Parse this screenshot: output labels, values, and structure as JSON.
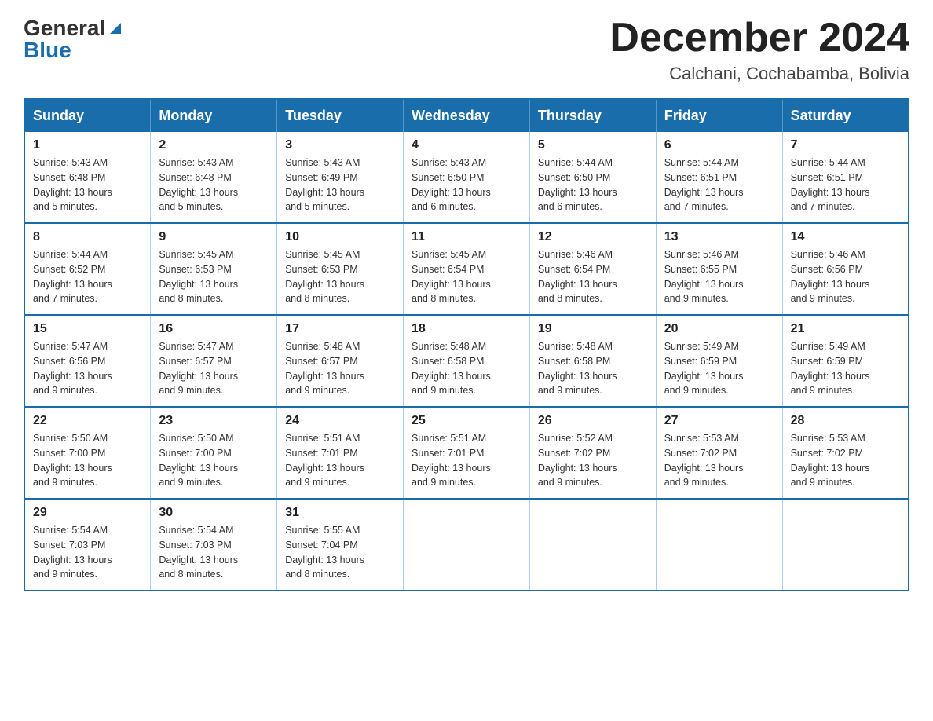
{
  "header": {
    "logo_line1": "General",
    "logo_line2": "Blue",
    "month_title": "December 2024",
    "location": "Calchani, Cochabamba, Bolivia"
  },
  "days_of_week": [
    "Sunday",
    "Monday",
    "Tuesday",
    "Wednesday",
    "Thursday",
    "Friday",
    "Saturday"
  ],
  "weeks": [
    [
      {
        "day": "1",
        "sunrise": "5:43 AM",
        "sunset": "6:48 PM",
        "daylight": "13 hours and 5 minutes."
      },
      {
        "day": "2",
        "sunrise": "5:43 AM",
        "sunset": "6:48 PM",
        "daylight": "13 hours and 5 minutes."
      },
      {
        "day": "3",
        "sunrise": "5:43 AM",
        "sunset": "6:49 PM",
        "daylight": "13 hours and 5 minutes."
      },
      {
        "day": "4",
        "sunrise": "5:43 AM",
        "sunset": "6:50 PM",
        "daylight": "13 hours and 6 minutes."
      },
      {
        "day": "5",
        "sunrise": "5:44 AM",
        "sunset": "6:50 PM",
        "daylight": "13 hours and 6 minutes."
      },
      {
        "day": "6",
        "sunrise": "5:44 AM",
        "sunset": "6:51 PM",
        "daylight": "13 hours and 7 minutes."
      },
      {
        "day": "7",
        "sunrise": "5:44 AM",
        "sunset": "6:51 PM",
        "daylight": "13 hours and 7 minutes."
      }
    ],
    [
      {
        "day": "8",
        "sunrise": "5:44 AM",
        "sunset": "6:52 PM",
        "daylight": "13 hours and 7 minutes."
      },
      {
        "day": "9",
        "sunrise": "5:45 AM",
        "sunset": "6:53 PM",
        "daylight": "13 hours and 8 minutes."
      },
      {
        "day": "10",
        "sunrise": "5:45 AM",
        "sunset": "6:53 PM",
        "daylight": "13 hours and 8 minutes."
      },
      {
        "day": "11",
        "sunrise": "5:45 AM",
        "sunset": "6:54 PM",
        "daylight": "13 hours and 8 minutes."
      },
      {
        "day": "12",
        "sunrise": "5:46 AM",
        "sunset": "6:54 PM",
        "daylight": "13 hours and 8 minutes."
      },
      {
        "day": "13",
        "sunrise": "5:46 AM",
        "sunset": "6:55 PM",
        "daylight": "13 hours and 9 minutes."
      },
      {
        "day": "14",
        "sunrise": "5:46 AM",
        "sunset": "6:56 PM",
        "daylight": "13 hours and 9 minutes."
      }
    ],
    [
      {
        "day": "15",
        "sunrise": "5:47 AM",
        "sunset": "6:56 PM",
        "daylight": "13 hours and 9 minutes."
      },
      {
        "day": "16",
        "sunrise": "5:47 AM",
        "sunset": "6:57 PM",
        "daylight": "13 hours and 9 minutes."
      },
      {
        "day": "17",
        "sunrise": "5:48 AM",
        "sunset": "6:57 PM",
        "daylight": "13 hours and 9 minutes."
      },
      {
        "day": "18",
        "sunrise": "5:48 AM",
        "sunset": "6:58 PM",
        "daylight": "13 hours and 9 minutes."
      },
      {
        "day": "19",
        "sunrise": "5:48 AM",
        "sunset": "6:58 PM",
        "daylight": "13 hours and 9 minutes."
      },
      {
        "day": "20",
        "sunrise": "5:49 AM",
        "sunset": "6:59 PM",
        "daylight": "13 hours and 9 minutes."
      },
      {
        "day": "21",
        "sunrise": "5:49 AM",
        "sunset": "6:59 PM",
        "daylight": "13 hours and 9 minutes."
      }
    ],
    [
      {
        "day": "22",
        "sunrise": "5:50 AM",
        "sunset": "7:00 PM",
        "daylight": "13 hours and 9 minutes."
      },
      {
        "day": "23",
        "sunrise": "5:50 AM",
        "sunset": "7:00 PM",
        "daylight": "13 hours and 9 minutes."
      },
      {
        "day": "24",
        "sunrise": "5:51 AM",
        "sunset": "7:01 PM",
        "daylight": "13 hours and 9 minutes."
      },
      {
        "day": "25",
        "sunrise": "5:51 AM",
        "sunset": "7:01 PM",
        "daylight": "13 hours and 9 minutes."
      },
      {
        "day": "26",
        "sunrise": "5:52 AM",
        "sunset": "7:02 PM",
        "daylight": "13 hours and 9 minutes."
      },
      {
        "day": "27",
        "sunrise": "5:53 AM",
        "sunset": "7:02 PM",
        "daylight": "13 hours and 9 minutes."
      },
      {
        "day": "28",
        "sunrise": "5:53 AM",
        "sunset": "7:02 PM",
        "daylight": "13 hours and 9 minutes."
      }
    ],
    [
      {
        "day": "29",
        "sunrise": "5:54 AM",
        "sunset": "7:03 PM",
        "daylight": "13 hours and 9 minutes."
      },
      {
        "day": "30",
        "sunrise": "5:54 AM",
        "sunset": "7:03 PM",
        "daylight": "13 hours and 8 minutes."
      },
      {
        "day": "31",
        "sunrise": "5:55 AM",
        "sunset": "7:04 PM",
        "daylight": "13 hours and 8 minutes."
      },
      null,
      null,
      null,
      null
    ]
  ],
  "labels": {
    "sunrise": "Sunrise:",
    "sunset": "Sunset:",
    "daylight": "Daylight:"
  }
}
